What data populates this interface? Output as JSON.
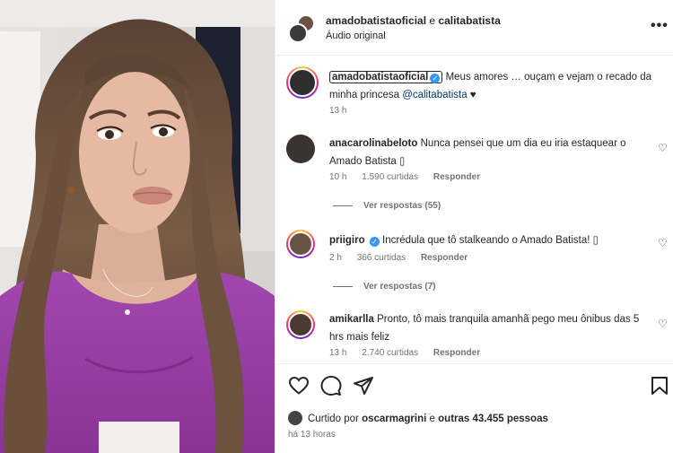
{
  "header": {
    "user1": "amadobatistaoficial",
    "joiner": "e",
    "user2": "calitabatista",
    "audio": "Áudio original",
    "more_icon": "more-horizontal-icon"
  },
  "caption": {
    "username": "amadobatistaoficial",
    "text": "Meus amores … ouçam e vejam o recado da minha princesa",
    "mention": "@calitabatista",
    "heart": "♥",
    "time": "13 h"
  },
  "comments": [
    {
      "username": "anacarolinabeloto",
      "text": "Nunca pensei que um dia eu iria estaquear o Amado Batista ▯",
      "time": "10 h",
      "likes": "1.590 curtidas",
      "reply": "Responder",
      "view_replies": "Ver respostas (55)"
    },
    {
      "username": "priigiro",
      "text": "Incrédula que tô stalkeando o Amado Batista! ▯",
      "time": "2 h",
      "likes": "366 curtidas",
      "reply": "Responder",
      "view_replies": "Ver respostas (7)"
    },
    {
      "username": "amikarlla",
      "text": "Pronto, tô mais tranquila amanhã pego meu ônibus das 5 hrs mais feliz",
      "time": "13 h",
      "likes": "2.740 curtidas",
      "reply": "Responder"
    }
  ],
  "footer": {
    "liked_prefix": "Curtido por",
    "liked_user": "oscarmagrini",
    "liked_mid": "e",
    "liked_others": "outras 43.455 pessoas",
    "ago": "há 13 horas"
  },
  "colors": {
    "verified": "#3897f0",
    "mention": "#00376b",
    "secondary_text": "#737373",
    "blouse": "#9b3fa6"
  }
}
